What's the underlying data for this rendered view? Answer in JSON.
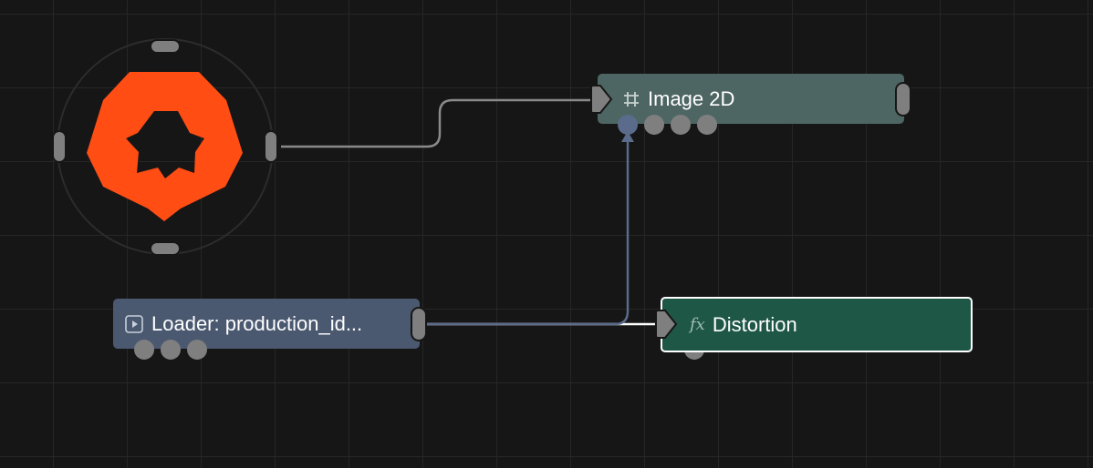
{
  "colors": {
    "background": "#161616",
    "grid": "#262626",
    "image_node": "#4e6663",
    "loader_node": "#4a5870",
    "distortion_node": "#1f5747",
    "logo": "#ff4d14",
    "port": "#7f7f7f",
    "wire_gray": "#8a8a8a",
    "wire_white": "#ffffff",
    "wire_blue": "#5a6b8c"
  },
  "nodes": {
    "image2d": {
      "title": "Image 2D",
      "icon": "frame-hash-icon"
    },
    "loader": {
      "title": "Loader: production_id...",
      "icon": "play-square-icon"
    },
    "distortion": {
      "title": "Distortion",
      "icon": "fx-icon",
      "icon_text": "fx"
    }
  },
  "logo": {
    "name": "bad-logo-icon"
  }
}
